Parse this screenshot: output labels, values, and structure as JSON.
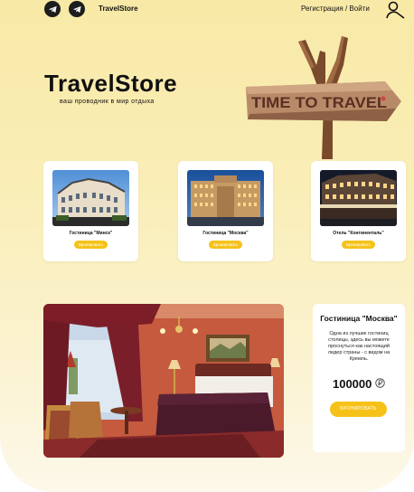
{
  "header": {
    "brand": "TravelStore",
    "auth_label": "Регистрация / Войти",
    "social_icons": [
      "telegram-icon",
      "telegram-icon"
    ]
  },
  "hero": {
    "title": "TravelStore",
    "subtitle": "ваш проводник в мир отдыха",
    "sign_text": "TIME TO TRAVEL"
  },
  "cards": [
    {
      "name": "Гостиница \"Минск\"",
      "button": "Бронировать"
    },
    {
      "name": "Гостиница \"Москва\"",
      "button": "Бронировать"
    },
    {
      "name": "Отель \"Континенталь\"",
      "button": "Бронировать"
    }
  ],
  "featured": {
    "title": "Гостиница \"Москва\"",
    "description": "Одна из лучших гостиниц столицы, здесь вы можете проснуться как настоящий лидер страны - с видом на Кремль.",
    "price": "100000",
    "currency_icon": "ruble-icon",
    "button": "БРОНИРОВАТЬ"
  },
  "colors": {
    "accent": "#f6c21a",
    "background_top": "#f8e9a6",
    "background_bottom": "#fdf8ea",
    "text": "#111111"
  }
}
